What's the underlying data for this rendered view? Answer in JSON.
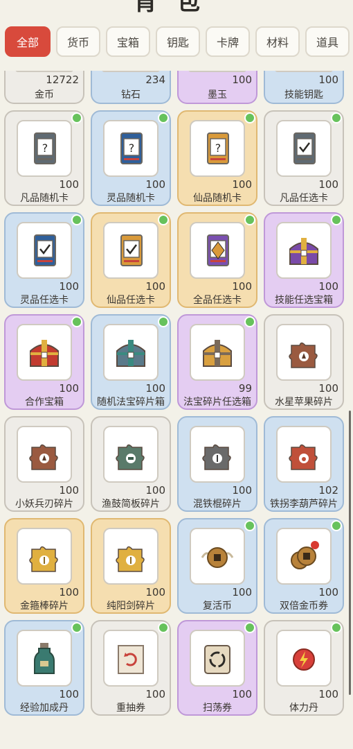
{
  "title": "背包",
  "tabs": [
    "全部",
    "货币",
    "宝箱",
    "钥匙",
    "卡牌",
    "材料",
    "道具"
  ],
  "active_tab": "全部",
  "colors": {
    "active_tab": "#d84a3c",
    "badge": "#67c25c",
    "gray": "#eeece7",
    "blue": "#cfe0f0",
    "gold": "#f5deb0",
    "purple": "#e4cdf2"
  },
  "partial_row": [
    {
      "name": "金币",
      "count": "12722",
      "quality": "gray"
    },
    {
      "name": "钻石",
      "count": "234",
      "quality": "blue"
    },
    {
      "name": "墨玉",
      "count": "100",
      "quality": "purple"
    },
    {
      "name": "技能钥匙",
      "count": "100",
      "quality": "blue"
    }
  ],
  "items": [
    {
      "name": "凡品随机卡",
      "count": "100",
      "quality": "gray",
      "icon": "card-random-gray",
      "badge": true
    },
    {
      "name": "灵品随机卡",
      "count": "100",
      "quality": "blue",
      "icon": "card-random-blue",
      "badge": true
    },
    {
      "name": "仙品随机卡",
      "count": "100",
      "quality": "gold",
      "icon": "card-random-gold",
      "badge": true
    },
    {
      "name": "凡品任选卡",
      "count": "100",
      "quality": "gray",
      "icon": "card-select-gray",
      "badge": true
    },
    {
      "name": "灵品任选卡",
      "count": "100",
      "quality": "blue",
      "icon": "card-select-blue",
      "badge": true
    },
    {
      "name": "仙品任选卡",
      "count": "100",
      "quality": "gold",
      "icon": "card-select-gold",
      "badge": true
    },
    {
      "name": "全品任选卡",
      "count": "100",
      "quality": "gold",
      "icon": "card-select-all",
      "badge": true
    },
    {
      "name": "技能任选宝箱",
      "count": "100",
      "quality": "purple",
      "icon": "chest-purple",
      "badge": true
    },
    {
      "name": "合作宝箱",
      "count": "100",
      "quality": "purple",
      "icon": "chest-red",
      "badge": true
    },
    {
      "name": "随机法宝碎片箱",
      "count": "100",
      "quality": "blue",
      "icon": "chest-teal",
      "badge": true
    },
    {
      "name": "法宝碎片任选箱",
      "count": "99",
      "quality": "purple",
      "icon": "chest-gold",
      "badge": true
    },
    {
      "name": "水星苹果碎片",
      "count": "100",
      "quality": "gray",
      "icon": "fragment-brown",
      "badge": false
    },
    {
      "name": "小妖兵刃碎片",
      "count": "100",
      "quality": "gray",
      "icon": "fragment-brown",
      "badge": false
    },
    {
      "name": "渔鼓简板碎片",
      "count": "100",
      "quality": "gray",
      "icon": "fragment-green",
      "badge": false
    },
    {
      "name": "混铁棍碎片",
      "count": "100",
      "quality": "blue",
      "icon": "fragment-gray",
      "badge": false
    },
    {
      "name": "铁拐李葫芦碎片",
      "count": "102",
      "quality": "blue",
      "icon": "fragment-red",
      "badge": false
    },
    {
      "name": "金箍棒碎片",
      "count": "100",
      "quality": "gold",
      "icon": "fragment-yellow",
      "badge": false
    },
    {
      "name": "纯阳剑碎片",
      "count": "100",
      "quality": "gold",
      "icon": "fragment-yellow",
      "badge": false
    },
    {
      "name": "复活币",
      "count": "100",
      "quality": "blue",
      "icon": "coin-wings",
      "badge": true
    },
    {
      "name": "双倍金币券",
      "count": "100",
      "quality": "blue",
      "icon": "coin-double",
      "badge": true
    },
    {
      "name": "经验加成丹",
      "count": "100",
      "quality": "blue",
      "icon": "potion-bottle",
      "badge": true
    },
    {
      "name": "重抽券",
      "count": "100",
      "quality": "gray",
      "icon": "reroll-ticket",
      "badge": true
    },
    {
      "name": "扫荡券",
      "count": "100",
      "quality": "purple",
      "icon": "sweep-ticket",
      "badge": true
    },
    {
      "name": "体力丹",
      "count": "100",
      "quality": "gray",
      "icon": "stamina-pill",
      "badge": true
    }
  ]
}
